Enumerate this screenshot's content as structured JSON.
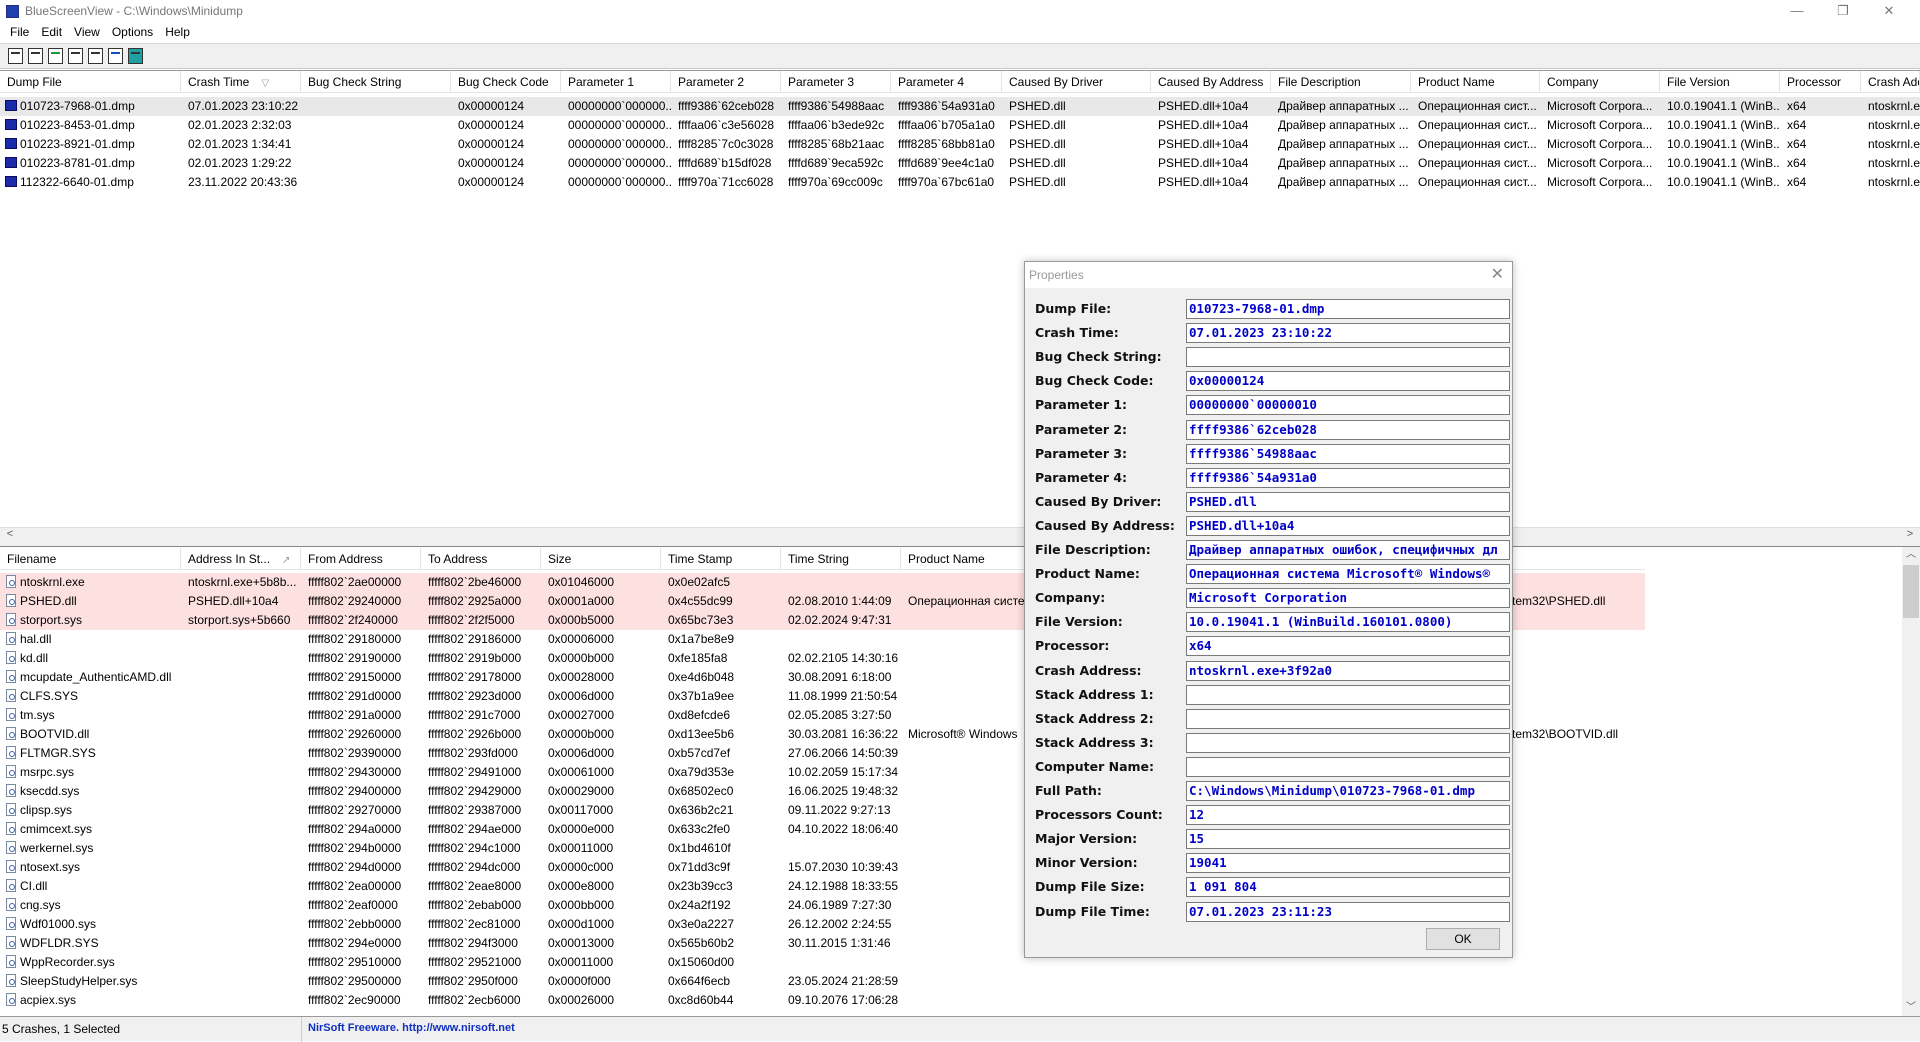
{
  "window": {
    "title": "BlueScreenView  -  C:\\Windows\\Minidump",
    "minimize": "—",
    "maximize": "❐",
    "close": "✕"
  },
  "menu": [
    "File",
    "Edit",
    "View",
    "Options",
    "Help"
  ],
  "toolbar": [
    "properties-icon",
    "save-icon",
    "refresh-icon",
    "copy-icon",
    "report-icon",
    "find-icon",
    "exit-icon"
  ],
  "upper_table": {
    "columns": [
      "Dump File",
      "Crash Time",
      "Bug Check String",
      "Bug Check Code",
      "Parameter 1",
      "Parameter 2",
      "Parameter 3",
      "Parameter 4",
      "Caused By Driver",
      "Caused By Address",
      "File Description",
      "Product Name",
      "Company",
      "File Version",
      "Processor",
      "Crash Add"
    ],
    "sort_indicator": "▽",
    "rows": [
      [
        "010723-7968-01.dmp",
        "07.01.2023 23:10:22",
        "",
        "0x00000124",
        "00000000`000000...",
        "ffff9386`62ceb028",
        "ffff9386`54988aac",
        "ffff9386`54a931a0",
        "PSHED.dll",
        "PSHED.dll+10a4",
        "Драйвер аппаратных ...",
        "Операционная сист...",
        "Microsoft Corpora...",
        "10.0.19041.1 (WinB...",
        "x64",
        "ntoskrnl.e"
      ],
      [
        "010223-8453-01.dmp",
        "02.01.2023 2:32:03",
        "",
        "0x00000124",
        "00000000`000000...",
        "ffffaa06`c3e56028",
        "ffffaa06`b3ede92c",
        "ffffaa06`b705a1a0",
        "PSHED.dll",
        "PSHED.dll+10a4",
        "Драйвер аппаратных ...",
        "Операционная сист...",
        "Microsoft Corpora...",
        "10.0.19041.1 (WinB...",
        "x64",
        "ntoskrnl.e"
      ],
      [
        "010223-8921-01.dmp",
        "02.01.2023 1:34:41",
        "",
        "0x00000124",
        "00000000`000000...",
        "ffff8285`7c0c3028",
        "ffff8285`68b21aac",
        "ffff8285`68bb81a0",
        "PSHED.dll",
        "PSHED.dll+10a4",
        "Драйвер аппаратных ...",
        "Операционная сист...",
        "Microsoft Corpora...",
        "10.0.19041.1 (WinB...",
        "x64",
        "ntoskrnl.e"
      ],
      [
        "010223-8781-01.dmp",
        "02.01.2023 1:29:22",
        "",
        "0x00000124",
        "00000000`000000...",
        "ffffd689`b15df028",
        "ffffd689`9eca592c",
        "ffffd689`9ee4c1a0",
        "PSHED.dll",
        "PSHED.dll+10a4",
        "Драйвер аппаратных ...",
        "Операционная сист...",
        "Microsoft Corpora...",
        "10.0.19041.1 (WinB...",
        "x64",
        "ntoskrnl.e"
      ],
      [
        "112322-6640-01.dmp",
        "23.11.2022 20:43:36",
        "",
        "0x00000124",
        "00000000`000000...",
        "ffff970a`71cc6028",
        "ffff970a`69cc009c",
        "ffff970a`67bc61a0",
        "PSHED.dll",
        "PSHED.dll+10a4",
        "Драйвер аппаратных ...",
        "Операционная сист...",
        "Microsoft Corpora...",
        "10.0.19041.1 (WinB...",
        "x64",
        "ntoskrnl.e"
      ]
    ]
  },
  "lower_table": {
    "columns": [
      "Filename",
      "Address In St...",
      "From Address",
      "To Address",
      "Size",
      "Time Stamp",
      "Time String",
      "Product Name"
    ],
    "sort_indicator": "↗",
    "rows": [
      {
        "c": [
          "ntoskrnl.exe",
          "ntoskrnl.exe+5b8b...",
          "fffff802`2ae00000",
          "fffff802`2be46000",
          "0x01046000",
          "0x0e02afc5",
          "",
          ""
        ],
        "path": "",
        "hl": true
      },
      {
        "c": [
          "PSHED.dll",
          "PSHED.dll+10a4",
          "fffff802`29240000",
          "fffff802`2925a000",
          "0x0001a000",
          "0x4c55dc99",
          "02.08.2010 1:44:09",
          "Операционная систе"
        ],
        "path": "tem32\\PSHED.dll",
        "hl": true
      },
      {
        "c": [
          "storport.sys",
          "storport.sys+5b660",
          "fffff802`2f240000",
          "fffff802`2f2f5000",
          "0x000b5000",
          "0x65bc73e3",
          "02.02.2024 9:47:31",
          ""
        ],
        "path": "",
        "hl": true
      },
      {
        "c": [
          "hal.dll",
          "",
          "fffff802`29180000",
          "fffff802`29186000",
          "0x00006000",
          "0x1a7be8e9",
          "",
          ""
        ],
        "path": ""
      },
      {
        "c": [
          "kd.dll",
          "",
          "fffff802`29190000",
          "fffff802`2919b000",
          "0x0000b000",
          "0xfe185fa8",
          "02.02.2105 14:30:16",
          ""
        ],
        "path": ""
      },
      {
        "c": [
          "mcupdate_AuthenticAMD.dll",
          "",
          "fffff802`29150000",
          "fffff802`29178000",
          "0x00028000",
          "0xe4d6b048",
          "30.08.2091 6:18:00",
          ""
        ],
        "path": ""
      },
      {
        "c": [
          "CLFS.SYS",
          "",
          "fffff802`291d0000",
          "fffff802`2923d000",
          "0x0006d000",
          "0x37b1a9ee",
          "11.08.1999 21:50:54",
          ""
        ],
        "path": ""
      },
      {
        "c": [
          "tm.sys",
          "",
          "fffff802`291a0000",
          "fffff802`291c7000",
          "0x00027000",
          "0xd8efcde6",
          "02.05.2085 3:27:50",
          ""
        ],
        "path": ""
      },
      {
        "c": [
          "BOOTVID.dll",
          "",
          "fffff802`29260000",
          "fffff802`2926b000",
          "0x0000b000",
          "0xd13ee5b6",
          "30.03.2081 16:36:22",
          "Microsoft® Windows"
        ],
        "path": "tem32\\BOOTVID.dll"
      },
      {
        "c": [
          "FLTMGR.SYS",
          "",
          "fffff802`29390000",
          "fffff802`293fd000",
          "0x0006d000",
          "0xb57cd7ef",
          "27.06.2066 14:50:39",
          ""
        ],
        "path": ""
      },
      {
        "c": [
          "msrpc.sys",
          "",
          "fffff802`29430000",
          "fffff802`29491000",
          "0x00061000",
          "0xa79d353e",
          "10.02.2059 15:17:34",
          ""
        ],
        "path": ""
      },
      {
        "c": [
          "ksecdd.sys",
          "",
          "fffff802`29400000",
          "fffff802`29429000",
          "0x00029000",
          "0x68502ec0",
          "16.06.2025 19:48:32",
          ""
        ],
        "path": ""
      },
      {
        "c": [
          "clipsp.sys",
          "",
          "fffff802`29270000",
          "fffff802`29387000",
          "0x00117000",
          "0x636b2c21",
          "09.11.2022 9:27:13",
          ""
        ],
        "path": ""
      },
      {
        "c": [
          "cmimcext.sys",
          "",
          "fffff802`294a0000",
          "fffff802`294ae000",
          "0x0000e000",
          "0x633c2fe0",
          "04.10.2022 18:06:40",
          ""
        ],
        "path": ""
      },
      {
        "c": [
          "werkernel.sys",
          "",
          "fffff802`294b0000",
          "fffff802`294c1000",
          "0x00011000",
          "0x1bd4610f",
          "",
          ""
        ],
        "path": ""
      },
      {
        "c": [
          "ntosext.sys",
          "",
          "fffff802`294d0000",
          "fffff802`294dc000",
          "0x0000c000",
          "0x71dd3c9f",
          "15.07.2030 10:39:43",
          ""
        ],
        "path": ""
      },
      {
        "c": [
          "CI.dll",
          "",
          "fffff802`2ea00000",
          "fffff802`2eae8000",
          "0x000e8000",
          "0x23b39cc3",
          "24.12.1988 18:33:55",
          ""
        ],
        "path": ""
      },
      {
        "c": [
          "cng.sys",
          "",
          "fffff802`2eaf0000",
          "fffff802`2ebab000",
          "0x000bb000",
          "0x24a2f192",
          "24.06.1989 7:27:30",
          ""
        ],
        "path": ""
      },
      {
        "c": [
          "Wdf01000.sys",
          "",
          "fffff802`2ebb0000",
          "fffff802`2ec81000",
          "0x000d1000",
          "0x3e0a2227",
          "26.12.2002 2:24:55",
          ""
        ],
        "path": ""
      },
      {
        "c": [
          "WDFLDR.SYS",
          "",
          "fffff802`294e0000",
          "fffff802`294f3000",
          "0x00013000",
          "0x565b60b2",
          "30.11.2015 1:31:46",
          ""
        ],
        "path": ""
      },
      {
        "c": [
          "WppRecorder.sys",
          "",
          "fffff802`29510000",
          "fffff802`29521000",
          "0x00011000",
          "0x15060d00",
          "",
          ""
        ],
        "path": ""
      },
      {
        "c": [
          "SleepStudyHelper.sys",
          "",
          "fffff802`29500000",
          "fffff802`2950f000",
          "0x0000f000",
          "0x664f6ecb",
          "23.05.2024 21:28:59",
          ""
        ],
        "path": ""
      },
      {
        "c": [
          "acpiex.sys",
          "",
          "fffff802`2ec90000",
          "fffff802`2ecb6000",
          "0x00026000",
          "0xc8d60b44",
          "09.10.2076 17:06:28",
          ""
        ],
        "path": ""
      }
    ]
  },
  "status": {
    "count": "5 Crashes, 1 Selected",
    "credit": "NirSoft Freeware.  http://www.nirsoft.net"
  },
  "dialog": {
    "title": "Properties",
    "close": "✕",
    "ok_label": "OK",
    "fields": [
      {
        "label": "Dump File:",
        "value": "010723-7968-01.dmp"
      },
      {
        "label": "Crash Time:",
        "value": "07.01.2023 23:10:22"
      },
      {
        "label": "Bug Check String:",
        "value": ""
      },
      {
        "label": "Bug Check Code:",
        "value": "0x00000124"
      },
      {
        "label": "Parameter 1:",
        "value": "00000000`00000010"
      },
      {
        "label": "Parameter 2:",
        "value": "ffff9386`62ceb028"
      },
      {
        "label": "Parameter 3:",
        "value": "ffff9386`54988aac"
      },
      {
        "label": "Parameter 4:",
        "value": "ffff9386`54a931a0"
      },
      {
        "label": "Caused By Driver:",
        "value": "PSHED.dll"
      },
      {
        "label": "Caused By Address:",
        "value": "PSHED.dll+10a4"
      },
      {
        "label": "File Description:",
        "value": "Драйвер аппаратных ошибок, специфичных дл"
      },
      {
        "label": "Product Name:",
        "value": "Операционная система Microsoft® Windows®"
      },
      {
        "label": "Company:",
        "value": "Microsoft Corporation"
      },
      {
        "label": "File Version:",
        "value": "10.0.19041.1 (WinBuild.160101.0800)"
      },
      {
        "label": "Processor:",
        "value": "x64"
      },
      {
        "label": "Crash Address:",
        "value": "ntoskrnl.exe+3f92a0"
      },
      {
        "label": "Stack Address 1:",
        "value": ""
      },
      {
        "label": "Stack Address 2:",
        "value": ""
      },
      {
        "label": "Stack Address 3:",
        "value": ""
      },
      {
        "label": "Computer Name:",
        "value": ""
      },
      {
        "label": "Full Path:",
        "value": "C:\\Windows\\Minidump\\010723-7968-01.dmp"
      },
      {
        "label": "Processors Count:",
        "value": "12"
      },
      {
        "label": "Major Version:",
        "value": "15"
      },
      {
        "label": "Minor Version:",
        "value": "19041"
      },
      {
        "label": "Dump File Size:",
        "value": "1  091  804"
      },
      {
        "label": "Dump File Time:",
        "value": "07.01.2023 23:11:23"
      }
    ]
  },
  "colors": {
    "highlight_row": "#fde0e0",
    "selected_row": "#e8e8e8",
    "dialog_value": "#0000c8",
    "status_link": "#1030c0"
  }
}
